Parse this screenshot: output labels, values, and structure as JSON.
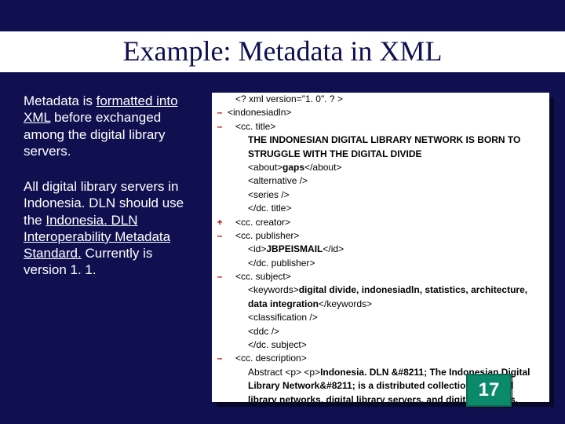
{
  "slide": {
    "title": "Example: Metadata in XML",
    "page_number": "17"
  },
  "body": {
    "p1_a": "Metadata is ",
    "p1_u": "formatted into XML",
    "p1_b": " before exchanged among the digital library servers.",
    "p2_a": "All digital library servers in Indonesia. DLN should use the ",
    "p2_u": "Indonesia. DLN Interoperability Metadata Standard.",
    "p2_b": " Currently is version 1. 1."
  },
  "code": {
    "l01": "<? xml version=\"1. 0\". ? >",
    "l02": "<indonesiadln>",
    "l03": "<cc. title>",
    "l04_bold": "THE INDONESIAN DIGITAL LIBRARY NETWORK IS BORN TO STRUGGLE WITH THE DIGITAL DIVIDE",
    "l05_a": "<about>",
    "l05_b": "gaps",
    "l05_c": "</about>",
    "l06": "<alternative />",
    "l07": "<series />",
    "l08": "</dc. title>",
    "l09": "<cc. creator>",
    "l10": "<cc. publisher>",
    "l11_a": "<id>",
    "l11_b": "JBPEISMAIL",
    "l11_c": "</id>",
    "l12": "</dc. publisher>",
    "l13": "<cc. subject>",
    "l14_a": "<keywords>",
    "l14_b": "digital divide, indonesiadln, statistics, architecture, data integration",
    "l14_c": "</keywords>",
    "l15": "<classification />",
    "l16": "<ddc />",
    "l17": "</dc. subject>",
    "l18": "<cc. description>",
    "l19_a": "Abstract <p> <p>",
    "l19_b": "Indonesia. DLN &#8211; The Indonesian Digital Library Network&#8211; is a distributed collection of digital library networks, digital library servers, and digital contents, metadata,"
  },
  "glyphs": {
    "plus": "+",
    "minus": "–"
  }
}
